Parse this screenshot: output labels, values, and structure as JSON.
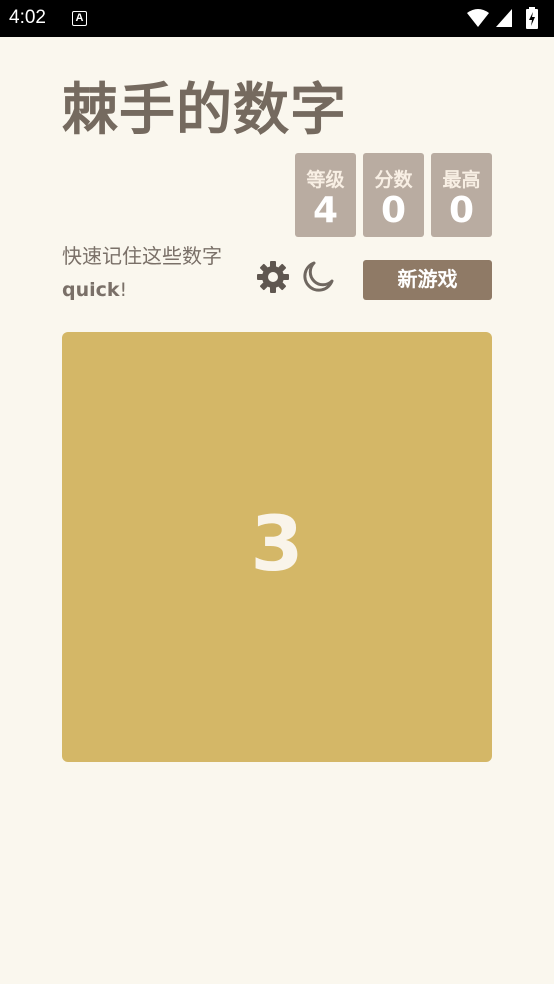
{
  "status_bar": {
    "time": "4:02",
    "notification_icon": "A",
    "icons": [
      "wifi-icon",
      "signal-icon",
      "battery-icon"
    ]
  },
  "app": {
    "title": "棘手的数字"
  },
  "stats": {
    "level_label": "等级",
    "level_value": "4",
    "score_label": "分数",
    "score_value": "0",
    "best_label": "最高",
    "best_value": "0"
  },
  "tagline": {
    "line1": "快速记住这些数字",
    "line2_bold": "quick",
    "line2_rest": "!"
  },
  "controls": {
    "settings_icon": "gear-icon",
    "theme_icon": "moon-icon",
    "new_game_label": "新游戏"
  },
  "board": {
    "number": "3"
  },
  "colors": {
    "background": "#faf7ee",
    "title": "#756a5f",
    "score_box": "#b9aca1",
    "new_game": "#8f7a66",
    "board": "#d4b767",
    "board_text": "#f9f4ea"
  }
}
